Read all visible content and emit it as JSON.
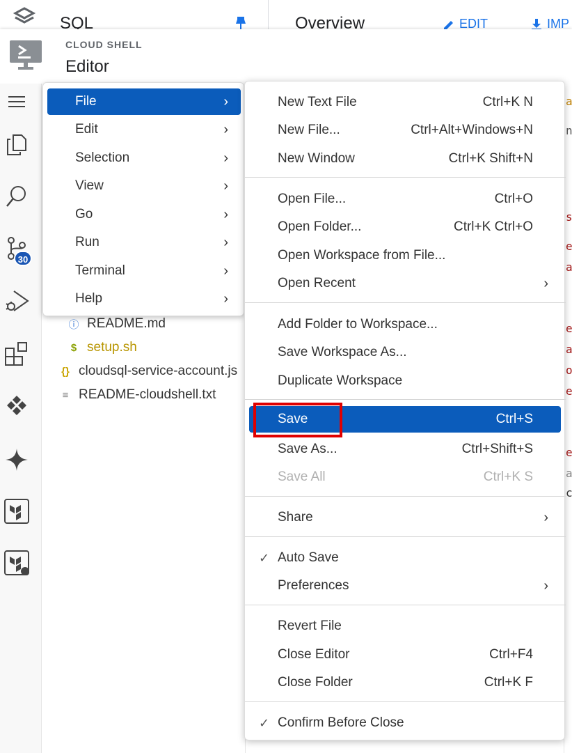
{
  "console": {
    "service_title": "SQL",
    "page_title": "Overview",
    "edit_label": "EDIT",
    "import_label": "IMP"
  },
  "shell": {
    "label_small": "CLOUD SHELL",
    "label_big": "Editor"
  },
  "activity_bar": {
    "scm_badge": "30"
  },
  "explorer": {
    "files": [
      {
        "name": "README.md",
        "icon": "ⓘ"
      },
      {
        "name": "setup.sh",
        "icon": "$"
      },
      {
        "name": "cloudsql-service-account.js",
        "icon": "{}"
      },
      {
        "name": "README-cloudshell.txt",
        "icon": "≡"
      }
    ]
  },
  "menubar": {
    "items": [
      {
        "label": "File",
        "chevron": "›"
      },
      {
        "label": "Edit",
        "chevron": "›"
      },
      {
        "label": "Selection",
        "chevron": "›"
      },
      {
        "label": "View",
        "chevron": "›"
      },
      {
        "label": "Go",
        "chevron": "›"
      },
      {
        "label": "Run",
        "chevron": "›"
      },
      {
        "label": "Terminal",
        "chevron": "›"
      },
      {
        "label": "Help",
        "chevron": "›"
      }
    ]
  },
  "file_menu": {
    "items": [
      {
        "label": "New Text File",
        "shortcut": "Ctrl+K N"
      },
      {
        "label": "New File...",
        "shortcut": "Ctrl+Alt+Windows+N"
      },
      {
        "label": "New Window",
        "shortcut": "Ctrl+K Shift+N"
      },
      {
        "label": "Open File...",
        "shortcut": "Ctrl+O"
      },
      {
        "label": "Open Folder...",
        "shortcut": "Ctrl+K Ctrl+O"
      },
      {
        "label": "Open Workspace from File...",
        "shortcut": ""
      },
      {
        "label": "Open Recent",
        "shortcut": "",
        "chevron": "›"
      },
      {
        "label": "Add Folder to Workspace...",
        "shortcut": ""
      },
      {
        "label": "Save Workspace As...",
        "shortcut": ""
      },
      {
        "label": "Duplicate Workspace",
        "shortcut": ""
      },
      {
        "label": "Save",
        "shortcut": "Ctrl+S"
      },
      {
        "label": "Save As...",
        "shortcut": "Ctrl+Shift+S"
      },
      {
        "label": "Save All",
        "shortcut": "Ctrl+K S"
      },
      {
        "label": "Share",
        "shortcut": "",
        "chevron": "›"
      },
      {
        "label": "Auto Save",
        "shortcut": "",
        "check": "✓"
      },
      {
        "label": "Preferences",
        "shortcut": "",
        "chevron": "›"
      },
      {
        "label": "Revert File",
        "shortcut": ""
      },
      {
        "label": "Close Editor",
        "shortcut": "Ctrl+F4"
      },
      {
        "label": "Close Folder",
        "shortcut": "Ctrl+K F"
      },
      {
        "label": "Confirm Before Close",
        "shortcut": "",
        "check": "✓"
      }
    ]
  },
  "colors": {
    "accent": "#0b5cbb",
    "link": "#1a73e8",
    "highlight_box": "#e00000",
    "disabled": "#b0b0b0"
  }
}
